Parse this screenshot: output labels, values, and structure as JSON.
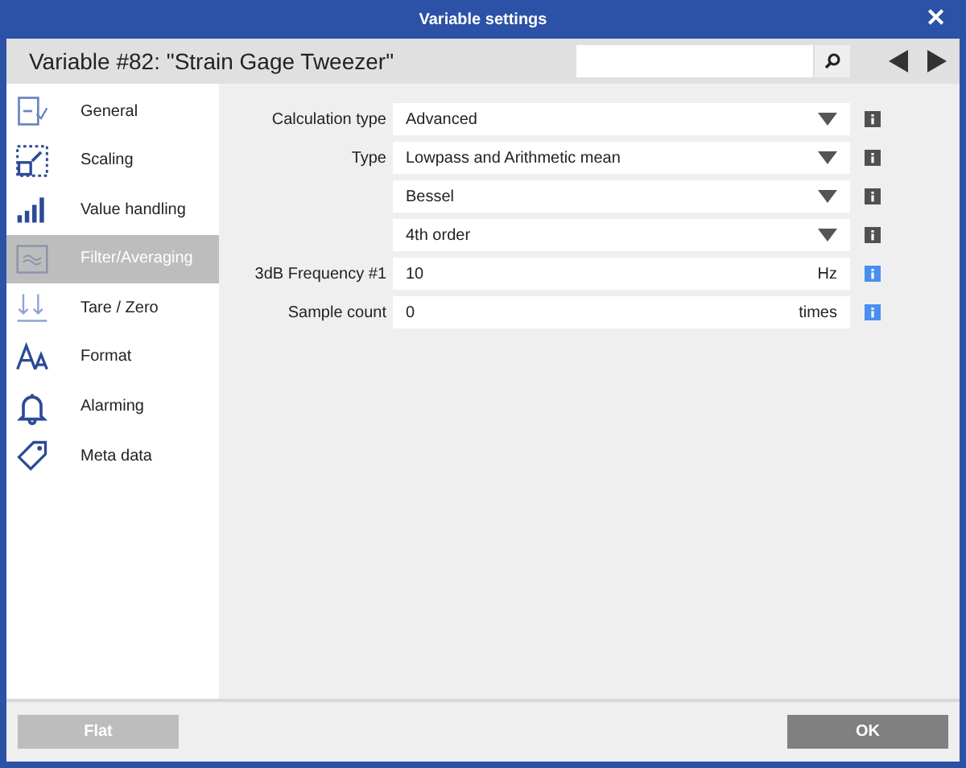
{
  "window": {
    "title": "Variable settings",
    "close": "✕"
  },
  "header": {
    "title": "Variable #82: \"Strain Gage Tweezer\""
  },
  "sidebar": {
    "items": [
      {
        "label": "General",
        "selected": false
      },
      {
        "label": "Scaling",
        "selected": false
      },
      {
        "label": "Value handling",
        "selected": false
      },
      {
        "label": "Filter/Averaging",
        "selected": true
      },
      {
        "label": "Tare / Zero",
        "selected": false
      },
      {
        "label": "Format",
        "selected": false
      },
      {
        "label": "Alarming",
        "selected": false
      },
      {
        "label": "Meta data",
        "selected": false
      }
    ]
  },
  "form": {
    "rows": [
      {
        "label": "Calculation type",
        "kind": "dropdown",
        "value": "Advanced",
        "color": "#505050"
      },
      {
        "label": "Type",
        "kind": "dropdown",
        "value": "Lowpass and Arithmetic mean",
        "color": "#505050"
      },
      {
        "kind": "dropdown",
        "value": "Bessel",
        "color": "#505050"
      },
      {
        "kind": "dropdown",
        "value": "4th order",
        "color": "#505050"
      },
      {
        "label": "3dB Frequency #1",
        "kind": "input",
        "value": "10",
        "unit": "Hz",
        "color": "#4a8ef0"
      },
      {
        "label": "Sample count",
        "kind": "input",
        "value": "0",
        "unit": "times",
        "color": "#4a8ef0"
      }
    ]
  },
  "footer": {
    "buttons": [
      {
        "label": "Flat",
        "disabled": true
      },
      {
        "label": "OK",
        "disabled": false
      }
    ]
  }
}
